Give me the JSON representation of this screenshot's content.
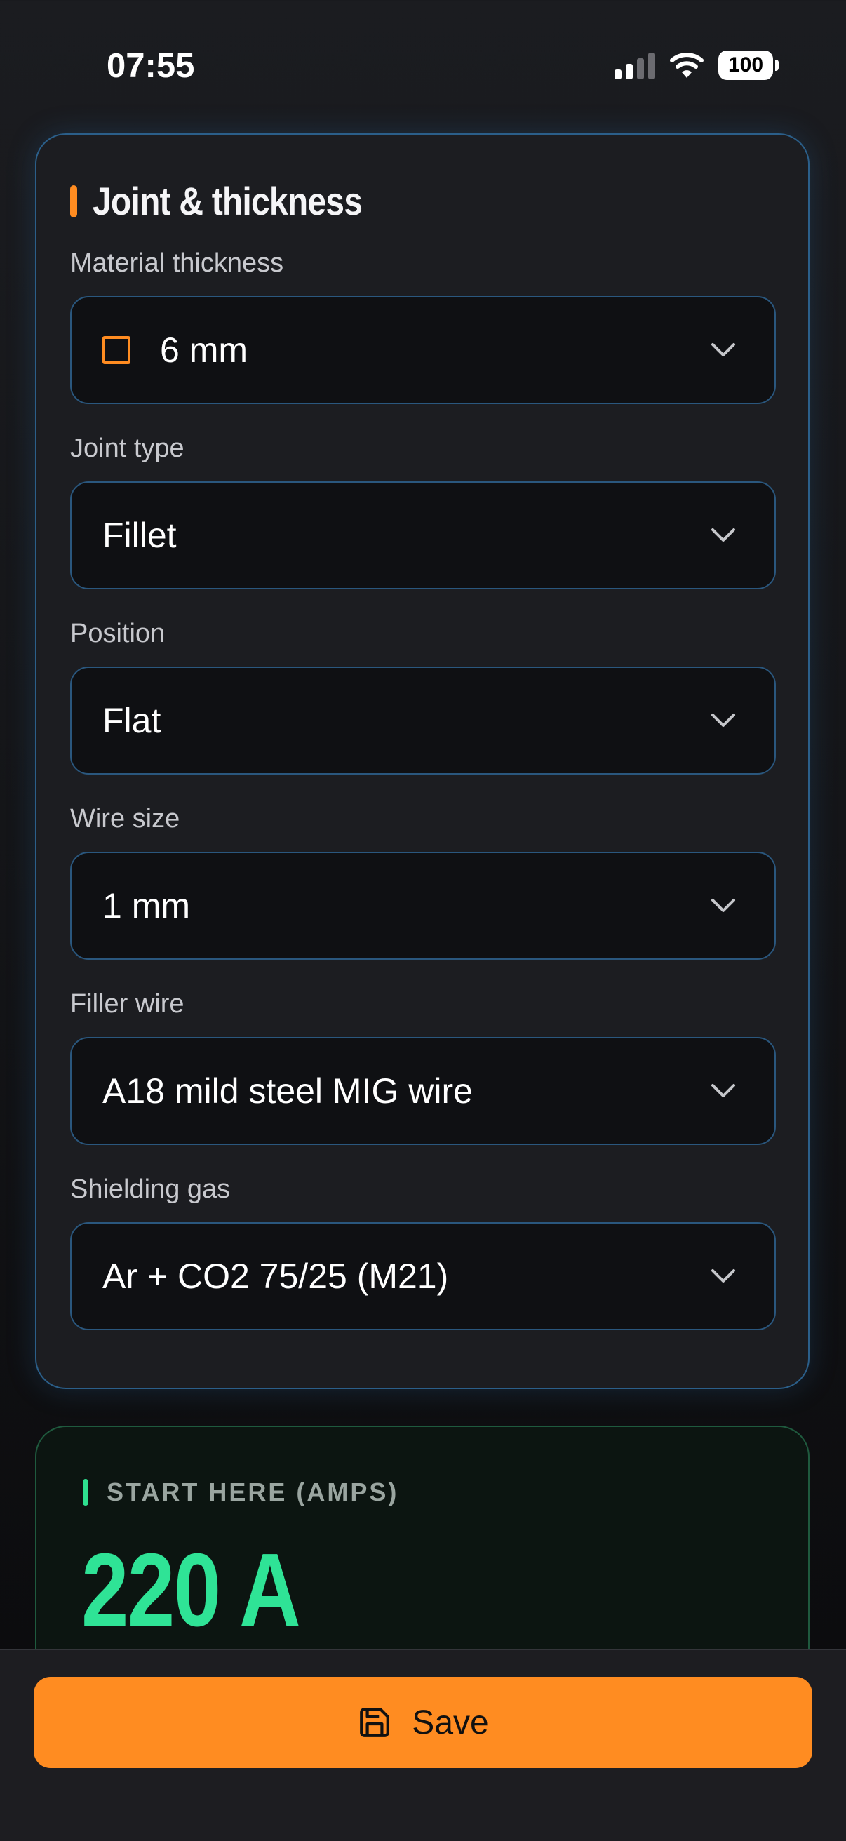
{
  "status_bar": {
    "time": "07:55",
    "battery": "100"
  },
  "card": {
    "title": "Joint & thickness",
    "fields": [
      {
        "label": "Material thickness",
        "value": "6 mm",
        "icon": "square-icon"
      },
      {
        "label": "Joint type",
        "value": "Fillet"
      },
      {
        "label": "Position",
        "value": "Flat"
      },
      {
        "label": "Wire size",
        "value": "1 mm"
      },
      {
        "label": "Filler wire",
        "value": "A18 mild steel MIG wire"
      },
      {
        "label": "Shielding gas",
        "value": "Ar + CO2 75/25 (M21)"
      }
    ]
  },
  "result": {
    "label": "START HERE (AMPS)",
    "value": "220 A"
  },
  "footer": {
    "save_label": "Save"
  },
  "colors": {
    "accent": "#ff8c21",
    "success": "#2fe396",
    "border": "#2b5f8a"
  }
}
